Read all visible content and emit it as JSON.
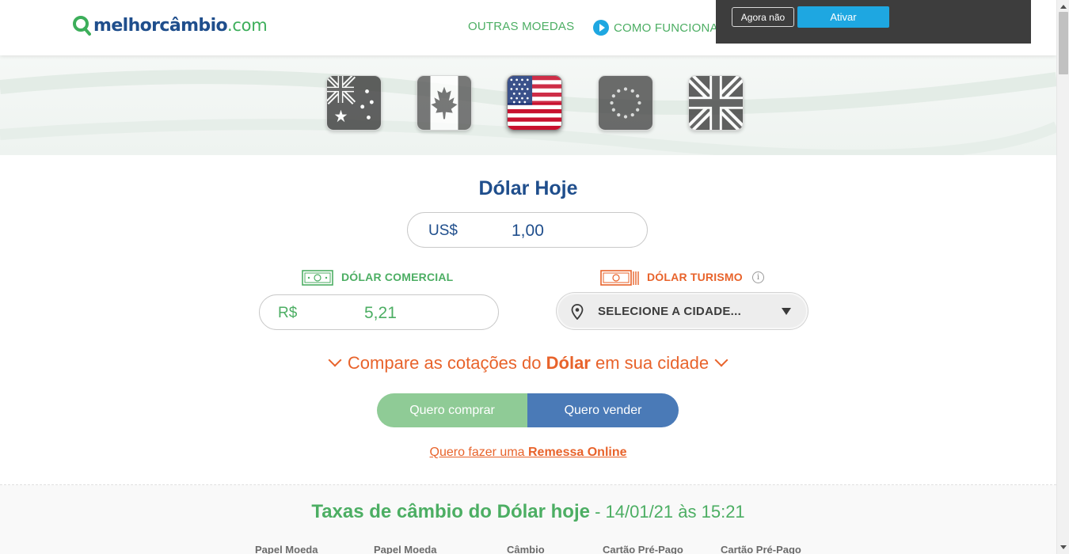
{
  "header": {
    "logo": {
      "main": "melhorcâmbio",
      "tld": ".com"
    },
    "nav": {
      "other_currencies": "OUTRAS MOEDAS",
      "how_it_works": "COMO FUNCIONA"
    }
  },
  "notification": {
    "not_now": "Agora não",
    "activate": "Ativar"
  },
  "flags": [
    {
      "name": "australia",
      "active": false
    },
    {
      "name": "canada",
      "active": false
    },
    {
      "name": "usa",
      "active": true
    },
    {
      "name": "euro",
      "active": false
    },
    {
      "name": "uk",
      "active": false
    }
  ],
  "main": {
    "title": "Dólar Hoje",
    "usd_prefix": "US$",
    "usd_value": "1,00",
    "commercial": {
      "label": "DÓLAR COMERCIAL",
      "prefix": "R$",
      "value": "5,21"
    },
    "tourism": {
      "label": "DÓLAR TURISMO",
      "info": "i",
      "city_placeholder": "SELECIONE A CIDADE..."
    },
    "compare": {
      "before": "Compare as cotações do ",
      "currency": "Dólar",
      "after": " em sua cidade"
    },
    "buy": "Quero comprar",
    "sell": "Quero vender",
    "remittance": {
      "before": "Quero fazer uma ",
      "link": "Remessa Online"
    }
  },
  "rates": {
    "title": "Taxas de câmbio do Dólar hoje",
    "date": " - 14/01/21 às 15:21",
    "columns": [
      "Papel Moeda",
      "Papel Moeda",
      "Câmbio",
      "Cartão Pré-Pago",
      "Cartão Pré-Pago"
    ]
  },
  "colors": {
    "brand_blue": "#1f4e8c",
    "brand_green": "#4cae63",
    "accent_orange": "#e8632b",
    "notify_blue": "#1ea7e1"
  }
}
